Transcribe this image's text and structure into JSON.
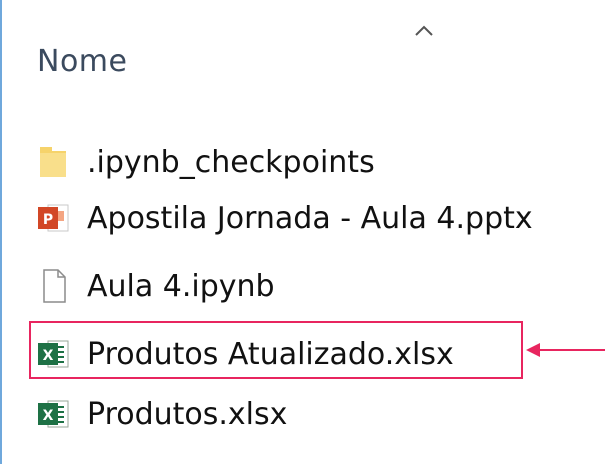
{
  "explorer": {
    "column_header": "Nome",
    "sort_icon": "chevron-up-icon",
    "files": [
      {
        "name": ".ipynb_checkpoints",
        "icon": "folder-icon"
      },
      {
        "name": "Apostila Jornada - Aula 4.pptx",
        "icon": "powerpoint-icon"
      },
      {
        "name": "Aula 4.ipynb",
        "icon": "blank-file-icon"
      },
      {
        "name": "Produtos Atualizado.xlsx",
        "icon": "excel-icon",
        "highlighted": true
      },
      {
        "name": "Produtos.xlsx",
        "icon": "excel-icon"
      }
    ]
  },
  "annotation": {
    "highlight_color": "#e8255f",
    "pointer_icon": "left-arrow-icon"
  },
  "colors": {
    "folder": "#f6d36b",
    "powerpoint": "#d24726",
    "excel": "#1e7145",
    "frame_border": "#6fa8dc"
  }
}
